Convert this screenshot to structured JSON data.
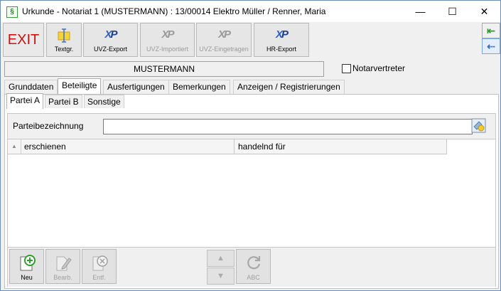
{
  "window": {
    "title": "Urkunde - Notariat 1 (MUSTERMANN) : 13/00014  Elektro Müller / Renner, Maria",
    "app_icon": "§",
    "minimize": "—",
    "maximize": "☐",
    "close": "✕"
  },
  "toolbar": {
    "exit_label": "EXIT",
    "textgr_label": "Textgr.",
    "uvz_export_label": "UVZ-Export",
    "uvz_importiert_label": "UVZ-Importiert",
    "uvz_eingetragen_label": "UVZ-Eingetragen",
    "hr_export_label": "HR-Export",
    "xp_x": "X",
    "xp_p": "P"
  },
  "side": {
    "arrow_in": "⇤",
    "arrow_out": "⇠"
  },
  "header": {
    "notar_name": "MUSTERMANN",
    "notarvertreter_label": "Notarvertreter",
    "notarvertreter_checked": false
  },
  "tabs": [
    "Grunddaten",
    "Beteiligte",
    "Ausfertigungen",
    "Bemerkungen",
    "Anzeigen / Registrierungen"
  ],
  "active_tab": "Beteiligte",
  "subtabs": [
    "Partei A",
    "Partei B",
    "Sonstige"
  ],
  "active_subtab": "Partei A",
  "form": {
    "parteibezeichnung_label": "Parteibezeichnung",
    "parteibezeichnung_value": ""
  },
  "grid": {
    "sort_indicator": "▲",
    "columns": [
      "erschienen",
      "handelnd für"
    ],
    "rows": []
  },
  "bottom": {
    "neu_label": "Neu",
    "bearb_label": "Bearb.",
    "entf_label": "Entf.",
    "up_label": "▲",
    "down_label": "▼",
    "abc_label": "ABC"
  },
  "colors": {
    "exit_red": "#d21010",
    "accent_green": "#2e9d2e",
    "accent_blue": "#3a6fc4"
  }
}
